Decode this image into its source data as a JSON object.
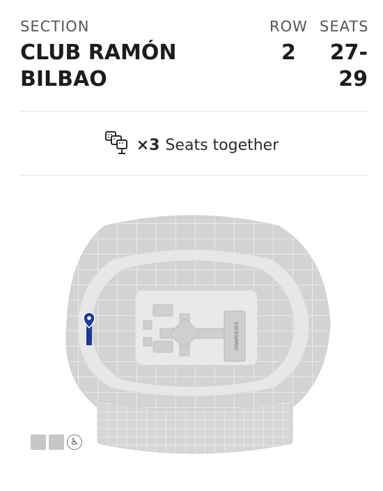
{
  "ticket": {
    "section_label": "SECTION",
    "row_label": "ROW",
    "seats_label": "SEATS",
    "section_line1": "CLUB RAMÓN",
    "section_line2": "BILBAO",
    "row": "2",
    "seats_line1": "27-",
    "seats_line2": "29"
  },
  "together": {
    "icon": "seats-together-icon",
    "count": "×3",
    "text": "Seats together"
  },
  "map": {
    "stage_label": "ESCENARIO",
    "pin_color": "#1e3a96",
    "section_fill": "#d6d6d6"
  },
  "legend": {
    "icons": [
      "standard-seat-icon",
      "standard-seat-icon",
      "wheelchair-icon"
    ],
    "accessible_glyph": "♿"
  }
}
